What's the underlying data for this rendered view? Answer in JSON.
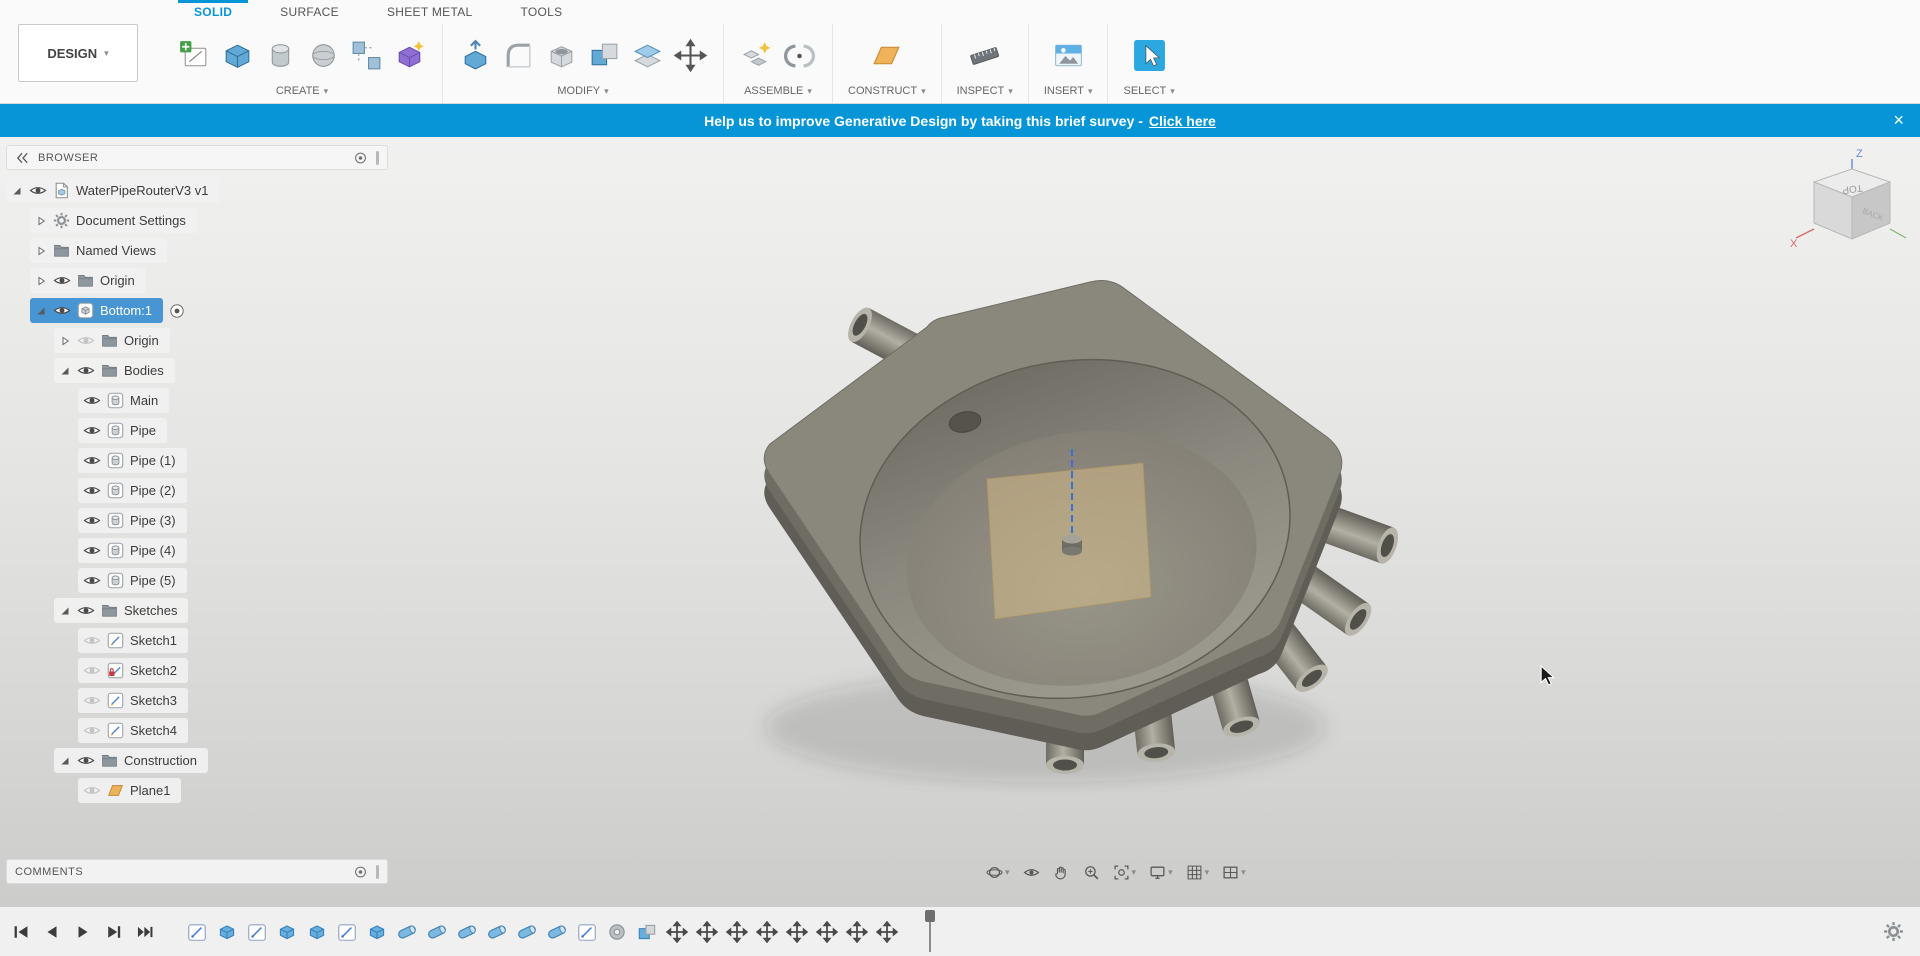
{
  "topbar": {
    "design_button": {
      "label": "DESIGN"
    },
    "tabs": [
      {
        "label": "SOLID",
        "active": true
      },
      {
        "label": "SURFACE",
        "active": false
      },
      {
        "label": "SHEET METAL",
        "active": false
      },
      {
        "label": "TOOLS",
        "active": false
      }
    ],
    "groups": [
      {
        "label": "CREATE",
        "icons": [
          "create-sketch",
          "create-box",
          "create-cylinder",
          "create-sphere",
          "create-pattern",
          "create-form"
        ]
      },
      {
        "label": "MODIFY",
        "icons": [
          "press-pull",
          "fillet",
          "shell",
          "combine",
          "offset-face",
          "move"
        ]
      },
      {
        "label": "ASSEMBLE",
        "icons": [
          "new-component",
          "joint"
        ]
      },
      {
        "label": "CONSTRUCT",
        "icons": [
          "construction-plane"
        ]
      },
      {
        "label": "INSPECT",
        "icons": [
          "measure"
        ]
      },
      {
        "label": "INSERT",
        "icons": [
          "insert-canvas"
        ]
      },
      {
        "label": "SELECT",
        "icons": [
          "select"
        ]
      }
    ]
  },
  "banner": {
    "message": "Help us to improve Generative Design by taking this brief survey -",
    "link_label": "Click here",
    "close_label": "×",
    "accent_color": "#0696d7"
  },
  "browser": {
    "title": "BROWSER",
    "tree": [
      {
        "label": "WaterPipeRouterV3 v1",
        "level": 0,
        "expander": "expanded",
        "eye": "on",
        "icon": "document"
      },
      {
        "label": "Document Settings",
        "level": 1,
        "expander": "collapsed",
        "eye": "none",
        "icon": "gear"
      },
      {
        "label": "Named Views",
        "level": 1,
        "expander": "collapsed",
        "eye": "none",
        "icon": "folder"
      },
      {
        "label": "Origin",
        "level": 1,
        "expander": "collapsed",
        "eye": "on",
        "icon": "folder"
      },
      {
        "label": "Bottom:1",
        "level": 1,
        "expander": "expanded",
        "eye": "on",
        "icon": "component",
        "selected": true,
        "activate": true
      },
      {
        "label": "Origin",
        "level": 2,
        "expander": "collapsed",
        "eye": "off",
        "icon": "folder"
      },
      {
        "label": "Bodies",
        "level": 2,
        "expander": "expanded",
        "eye": "on",
        "icon": "folder"
      },
      {
        "label": "Main",
        "level": 3,
        "eye": "on",
        "icon": "body"
      },
      {
        "label": "Pipe",
        "level": 3,
        "eye": "on",
        "icon": "body"
      },
      {
        "label": "Pipe (1)",
        "level": 3,
        "eye": "on",
        "icon": "body"
      },
      {
        "label": "Pipe (2)",
        "level": 3,
        "eye": "on",
        "icon": "body"
      },
      {
        "label": "Pipe (3)",
        "level": 3,
        "eye": "on",
        "icon": "body"
      },
      {
        "label": "Pipe (4)",
        "level": 3,
        "eye": "on",
        "icon": "body"
      },
      {
        "label": "Pipe (5)",
        "level": 3,
        "eye": "on",
        "icon": "body"
      },
      {
        "label": "Sketches",
        "level": 2,
        "expander": "expanded",
        "eye": "on",
        "icon": "folder"
      },
      {
        "label": "Sketch1",
        "level": 3,
        "eye": "off",
        "icon": "sketch"
      },
      {
        "label": "Sketch2",
        "level": 3,
        "eye": "off",
        "icon": "sketch-locked"
      },
      {
        "label": "Sketch3",
        "level": 3,
        "eye": "off",
        "icon": "sketch"
      },
      {
        "label": "Sketch4",
        "level": 3,
        "eye": "off",
        "icon": "sketch"
      },
      {
        "label": "Construction",
        "level": 2,
        "expander": "expanded",
        "eye": "on",
        "icon": "folder"
      },
      {
        "label": "Plane1",
        "level": 3,
        "eye": "off",
        "icon": "plane"
      }
    ]
  },
  "comments": {
    "title": "COMMENTS"
  },
  "viewcube": {
    "top_label": "TOP",
    "side_label": "BACK",
    "axis_x": "X",
    "axis_z": "Z"
  },
  "navbar": {
    "buttons": [
      {
        "icon": "orbit",
        "dropdown": true
      },
      {
        "icon": "look-at",
        "dropdown": false
      },
      {
        "icon": "pan",
        "dropdown": false
      },
      {
        "icon": "zoom",
        "dropdown": false
      },
      {
        "icon": "fit",
        "dropdown": true
      },
      {
        "icon": "display",
        "dropdown": true
      },
      {
        "icon": "grid",
        "dropdown": true
      },
      {
        "icon": "viewports",
        "dropdown": true
      }
    ]
  },
  "timeline": {
    "playback": [
      "go-to-start",
      "step-back",
      "play",
      "step-forward",
      "go-to-end"
    ],
    "features": [
      "sketch",
      "extrude",
      "sketch",
      "extrude",
      "extrude",
      "sketch",
      "extrude",
      "pipe",
      "pipe",
      "pipe",
      "pipe",
      "pipe",
      "pipe",
      "sketch",
      "revolve",
      "combine",
      "move",
      "move",
      "move",
      "move",
      "move",
      "move",
      "move",
      "move"
    ],
    "settings_icon": "gear"
  }
}
